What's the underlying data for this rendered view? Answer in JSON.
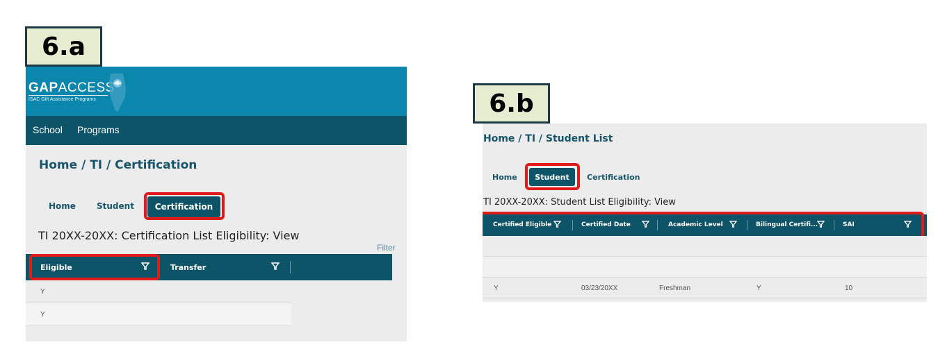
{
  "panel_a": {
    "step_label": "6.a",
    "logo": {
      "brand_bold": "GAP",
      "brand_light": "ACCESS",
      "tagline": "ISAC Gift Assistance Programs"
    },
    "nav": [
      "School",
      "Programs"
    ],
    "breadcrumb": "Home / TI / Certification",
    "tabs": [
      "Home",
      "Student",
      "Certification"
    ],
    "active_tab": "Certification",
    "view_title": "TI 20XX-20XX: Certification List Eligibility: View",
    "filter_link": "Filter",
    "columns": [
      "Eligible",
      "Transfer"
    ],
    "rows": [
      [
        "Y"
      ],
      [
        "Y"
      ]
    ]
  },
  "panel_b": {
    "step_label": "6.b",
    "breadcrumb": "Home / TI / Student List",
    "tabs": [
      "Home",
      "Student",
      "Certification"
    ],
    "active_tab": "Student",
    "view_title": "TI 20XX-20XX: Student List Eligibility: View",
    "columns": [
      "Certified Eligible",
      "Certified Date",
      "Academic Level",
      "Bilingual Certifi...",
      "SAI"
    ],
    "rows": [
      [
        "Y",
        "03/23/20XX",
        "Freshman",
        "Y",
        "10"
      ]
    ]
  },
  "colors": {
    "header": "#0e5468",
    "topbar": "#0b87ad",
    "highlight": "#e11a1a",
    "label_bg": "#e5eccf"
  }
}
